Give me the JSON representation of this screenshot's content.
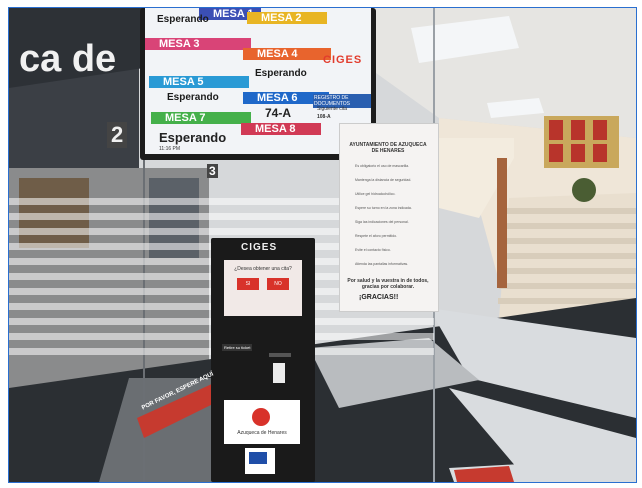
{
  "display": {
    "brand": "CIGES",
    "rows": [
      {
        "label": "MESA 1",
        "color": "#3b4fb5",
        "status": "Esperando"
      },
      {
        "label": "MESA 2",
        "color": "#e8b524"
      },
      {
        "label": "MESA 3",
        "color": "#d94477"
      },
      {
        "label": "MESA 4",
        "color": "#e8642d",
        "status": "Esperando"
      },
      {
        "label": "MESA 5",
        "color": "#2a9ad5",
        "status": "Esperando"
      },
      {
        "label": "MESA 6",
        "color": "#1f68c9",
        "ticket": "74-A"
      },
      {
        "label": "MESA 7",
        "color": "#45b04a",
        "status": "Esperando"
      },
      {
        "label": "MESA 8",
        "color": "#d13a55"
      }
    ],
    "side_title": "REGISTRO DE DOCUMENTOS",
    "side_label": "Siguiente cita",
    "side_ticket": "108-A",
    "clock": "11:16 PM"
  },
  "signage": {
    "wall_text": "ca de",
    "number_2": "2",
    "number_3": "3"
  },
  "kiosk": {
    "brand": "CIGES",
    "question": "¿Desea obtener una cita?",
    "yes": "SI",
    "no": "NO",
    "ticket_label": "Retire su ticket",
    "logo_text": "Azuqueca de Henares"
  },
  "poster": {
    "title": "AYUNTAMIENTO DE AZUQUECA DE HENARES",
    "lines": [
      "Es obligatorio el uso de mascarilla.",
      "Mantenga la distancia de seguridad.",
      "Utilice gel hidroalcohólico.",
      "Espere su turno en la zona indicada.",
      "Siga las indicaciones del personal.",
      "Respete el aforo permitido.",
      "Evite el contacto físico.",
      "Atienda las pantallas informativas."
    ],
    "footer": "Por salud y la vuestra in de todos, gracias por colaborar.",
    "thanks": "¡GRACIAS!!"
  },
  "floor": {
    "sign": "POR FAVOR, ESPERE AQUÍ"
  },
  "colors": {
    "kiosk_red": "#d8322a",
    "wood": "#c9a27a",
    "floor_dark": "#2b2f33",
    "floor_light": "#d9dcdf"
  }
}
